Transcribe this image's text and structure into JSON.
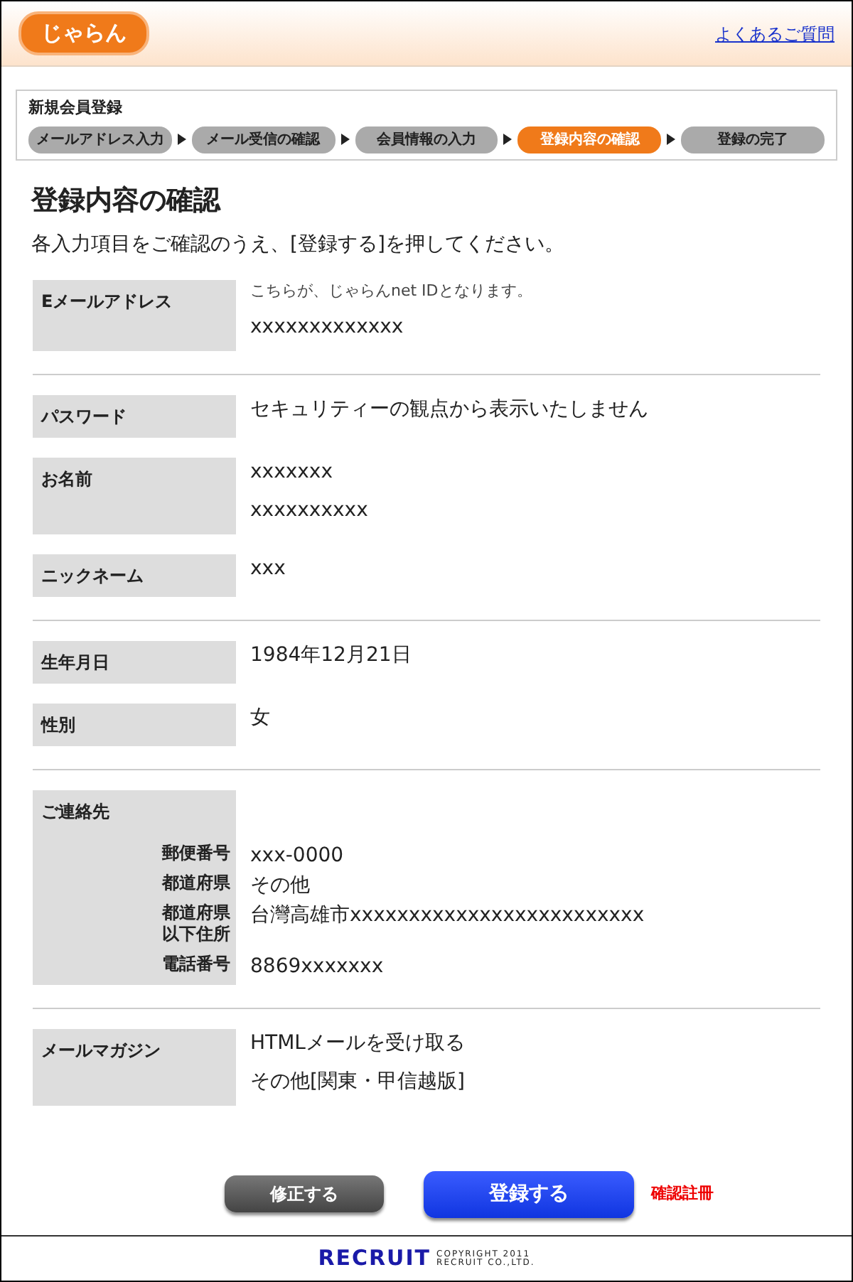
{
  "header": {
    "logo": "じゃらん",
    "help_link": "よくあるご質問"
  },
  "steps": {
    "title": "新規会員登録",
    "items": [
      {
        "label": "メールアドレス入力",
        "selected": false
      },
      {
        "label": "メール受信の確認",
        "selected": false
      },
      {
        "label": "会員情報の入力",
        "selected": false
      },
      {
        "label": "登録内容の確認",
        "selected": true
      },
      {
        "label": "登録の完了",
        "selected": false
      }
    ]
  },
  "heading": "登録内容の確認",
  "intro": "各入力項目をご確認のうえ、[登録する]を押してください。",
  "sections": [
    {
      "rows": [
        {
          "label": "Eメールアドレス",
          "note": "こちらが、じゃらんnet IDとなります。",
          "values": [
            "xxxxxxxxxxxxx"
          ]
        }
      ]
    },
    {
      "rows": [
        {
          "label": "パスワード",
          "values": [
            "セキュリティーの観点から表示いたしません"
          ]
        },
        {
          "label": "お名前",
          "values": [
            "xxxxxxx",
            "xxxxxxxxxx"
          ]
        },
        {
          "label": "ニックネーム",
          "values": [
            "xxx"
          ]
        }
      ]
    },
    {
      "rows": [
        {
          "label": "生年月日",
          "values": [
            "1984年12月21日"
          ]
        },
        {
          "label": "性別",
          "values": [
            "女"
          ]
        }
      ]
    },
    {
      "rows": [
        {
          "label": "ご連絡先",
          "fields": [
            {
              "label": "郵便番号",
              "value": "xxx-0000"
            },
            {
              "label": "都道府県",
              "value": "その他"
            },
            {
              "label": "都道府県以下住所",
              "value": "台灣高雄市xxxxxxxxxxxxxxxxxxxxxxxxx"
            },
            {
              "label": "電話番号",
              "value": "8869xxxxxxx"
            }
          ]
        }
      ]
    },
    {
      "rows": [
        {
          "label": "メールマガジン",
          "values": [
            "HTMLメールを受け取る",
            "その他[関東・甲信越版]"
          ]
        }
      ]
    }
  ],
  "buttons": [
    {
      "label": "修正する",
      "kind": "secondary"
    },
    {
      "label": "登録する",
      "kind": "primary"
    }
  ],
  "annotation": "確認註冊",
  "footer": {
    "brand": "RECRUIT",
    "copyright": [
      "COPYRIGHT 2011",
      "RECRUIT CO.,LTD."
    ]
  }
}
